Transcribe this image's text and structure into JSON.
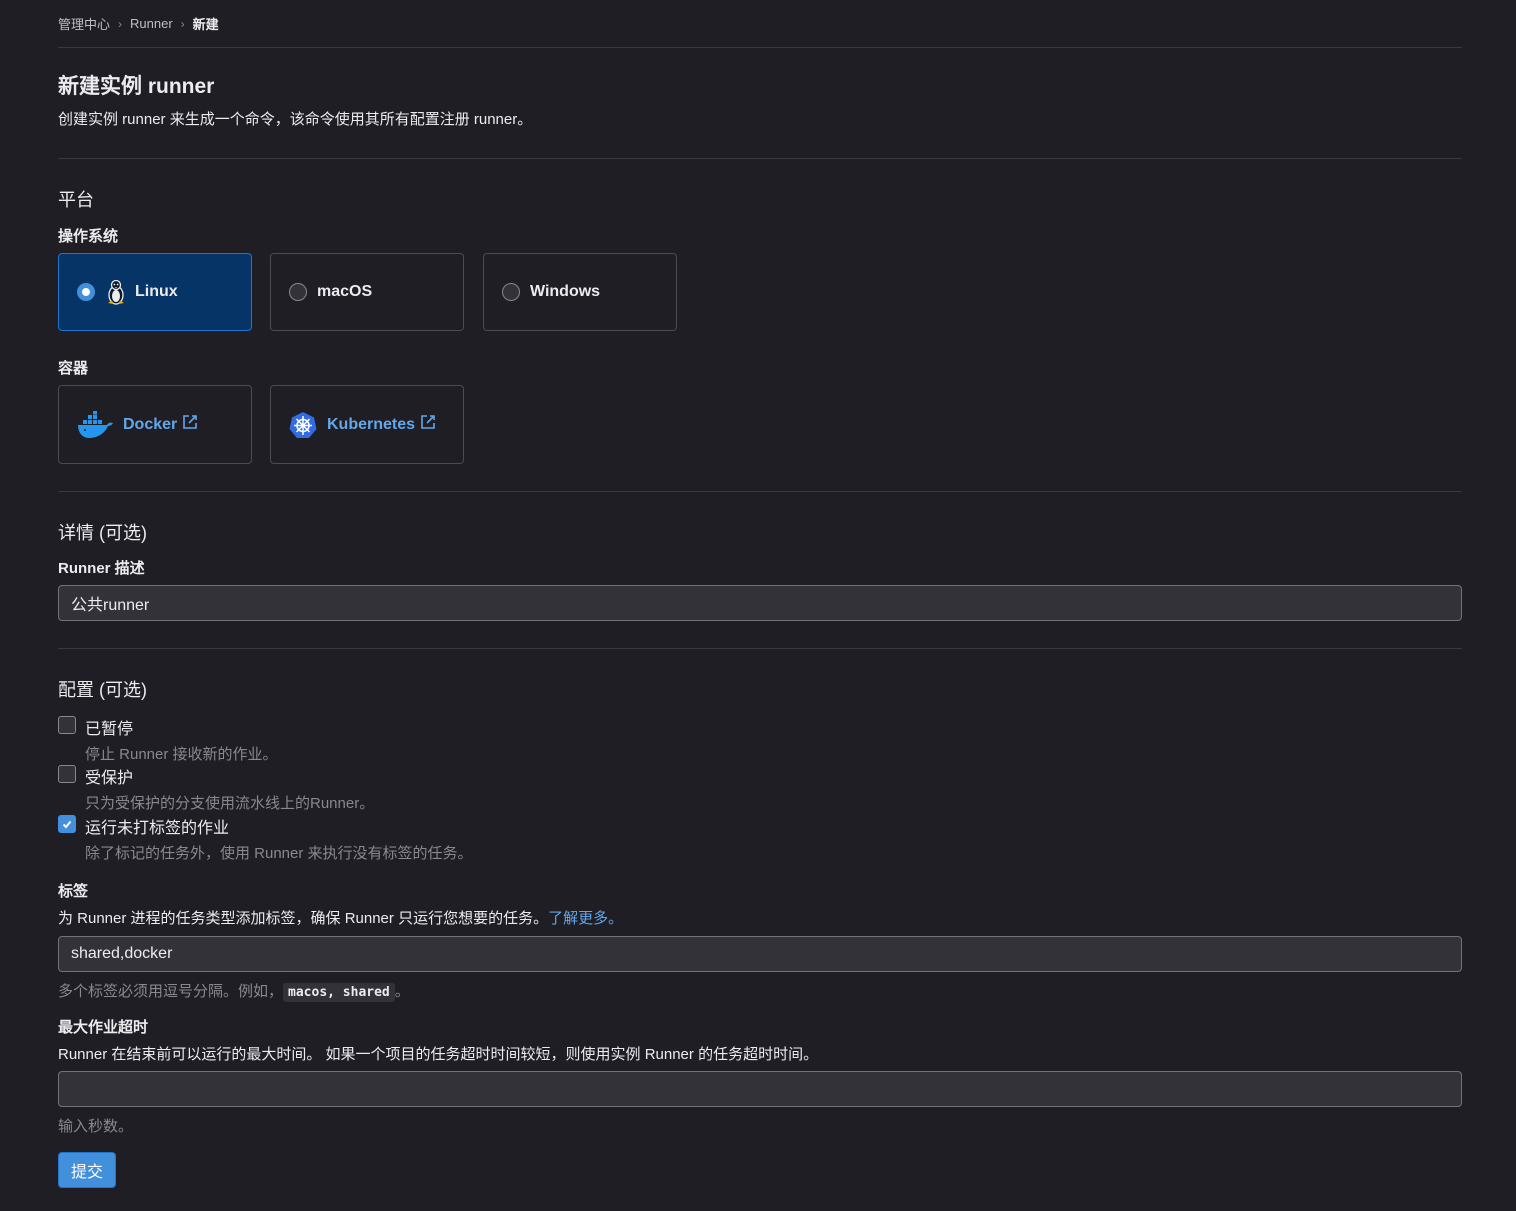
{
  "breadcrumb": {
    "items": [
      "管理中心",
      "Runner"
    ],
    "current": "新建"
  },
  "header": {
    "title": "新建实例 runner",
    "description": "创建实例 runner 来生成一个命令，该命令使用其所有配置注册 runner。"
  },
  "platform": {
    "heading": "平台",
    "os_label": "操作系统",
    "os_options": [
      "Linux",
      "macOS",
      "Windows"
    ],
    "os_selected": "Linux",
    "container_label": "容器",
    "containers": [
      "Docker",
      "Kubernetes"
    ]
  },
  "details": {
    "heading": "详情 (可选)",
    "description_label": "Runner 描述",
    "description_value": "公共runner"
  },
  "config": {
    "heading": "配置 (可选)",
    "paused": {
      "label": "已暂停",
      "help": "停止 Runner 接收新的作业。",
      "checked": false
    },
    "protected": {
      "label": "受保护",
      "help": "只为受保护的分支使用流水线上的Runner。",
      "checked": false
    },
    "untagged": {
      "label": "运行未打标签的作业",
      "help": "除了标记的任务外，使用 Runner 来执行没有标签的任务。",
      "checked": true
    }
  },
  "tags": {
    "label": "标签",
    "help": "为 Runner 进程的任务类型添加标签，确保 Runner 只运行您想要的任务。",
    "learn_more": "了解更多。",
    "value": "shared,docker",
    "hint_prefix": "多个标签必须用逗号分隔。例如，",
    "hint_example": "macos, shared",
    "hint_suffix": "。"
  },
  "timeout": {
    "label": "最大作业超时",
    "help": "Runner 在结束前可以运行的最大时间。 如果一个项目的任务超时时间较短，则使用实例 Runner 的任务超时时间。",
    "value": "",
    "hint": "输入秒数。"
  },
  "submit_label": "提交",
  "colors": {
    "accent": "#428fdc",
    "selected_card_bg": "#063466",
    "link": "#63a6e9",
    "background": "#1f1e24"
  },
  "icons": [
    "linux-tux-icon",
    "docker-icon",
    "kubernetes-icon",
    "external-link-icon",
    "check-icon",
    "chevron-right-icon"
  ]
}
